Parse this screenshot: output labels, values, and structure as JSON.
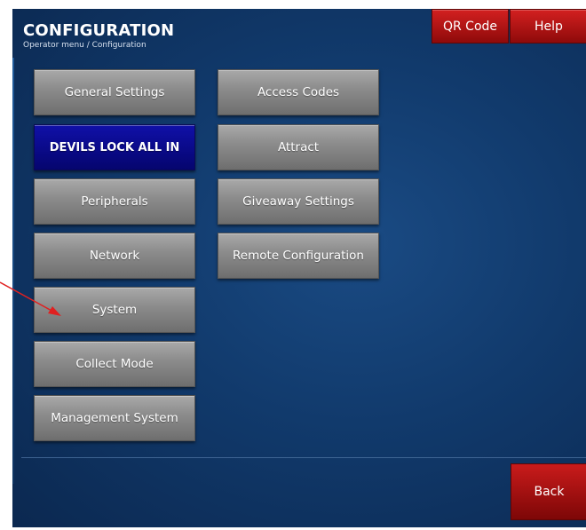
{
  "header": {
    "title": "CONFIGURATION",
    "breadcrumb": "Operator menu / Configuration"
  },
  "top_buttons": {
    "qr_code": "QR Code",
    "help": "Help"
  },
  "menu": {
    "left": [
      "General Settings",
      "DEVILS LOCK ALL IN",
      "Peripherals",
      "Network",
      "System",
      "Collect Mode",
      "Management System"
    ],
    "right": [
      "Access Codes",
      "Attract",
      "Giveaway Settings",
      "Remote Configuration"
    ],
    "active_item": "DEVILS LOCK ALL IN"
  },
  "footer": {
    "back": "Back"
  },
  "annotation": {
    "arrow_target": "System",
    "arrow_color": "#e02020"
  },
  "colors": {
    "background": "#113a6c",
    "accent_red": "#c91b1b",
    "active_blue": "#0a0a8a",
    "button_gray": "#8d8d8d"
  }
}
